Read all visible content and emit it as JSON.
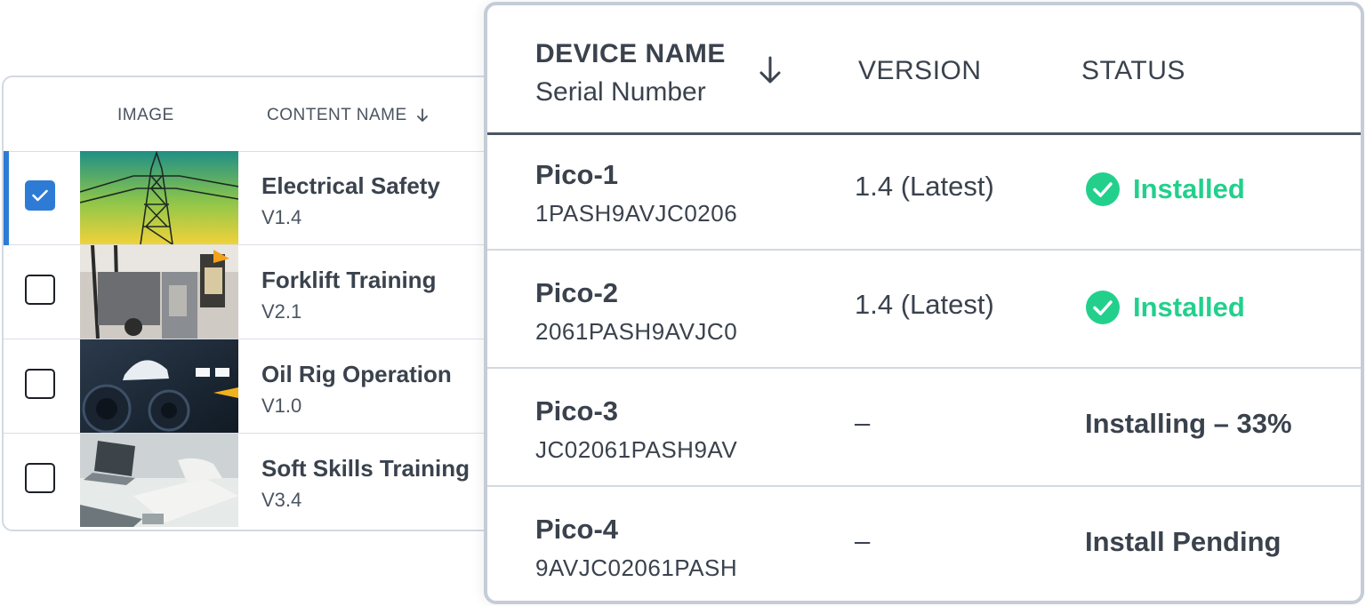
{
  "content_table": {
    "headers": {
      "image": "IMAGE",
      "content_name": "CONTENT NAME"
    },
    "rows": [
      {
        "title": "Electrical Safety",
        "version": "V1.4",
        "checked": true,
        "image": "power-tower-image"
      },
      {
        "title": "Forklift Training",
        "version": "V2.1",
        "checked": false,
        "image": "warehouse-forklift-image"
      },
      {
        "title": "Oil Rig Operation",
        "version": "V1.0",
        "checked": false,
        "image": "hard-hat-machinery-image"
      },
      {
        "title": "Soft Skills Training",
        "version": "V3.4",
        "checked": false,
        "image": "laptop-meeting-image"
      }
    ]
  },
  "device_table": {
    "headers": {
      "device_name": "DEVICE NAME",
      "serial_number": "Serial Number",
      "version": "VERSION",
      "status": "STATUS"
    },
    "rows": [
      {
        "name": "Pico-1",
        "serial": "1PASH9AVJC0206",
        "version": "1.4 (Latest)",
        "status": "Installed",
        "installed": true
      },
      {
        "name": "Pico-2",
        "serial": "2061PASH9AVJC0",
        "version": "1.4 (Latest)",
        "status": "Installed",
        "installed": true
      },
      {
        "name": "Pico-3",
        "serial": "JC02061PASH9AV",
        "version": "–",
        "status": "Installing – 33%",
        "installed": false
      },
      {
        "name": "Pico-4",
        "serial": "9AVJC02061PASH",
        "version": "–",
        "status": "Install Pending",
        "installed": false
      }
    ]
  },
  "colors": {
    "selected_accent": "#2e7bd6",
    "installed_green": "#22d08c",
    "text_dark": "#3a424d"
  }
}
